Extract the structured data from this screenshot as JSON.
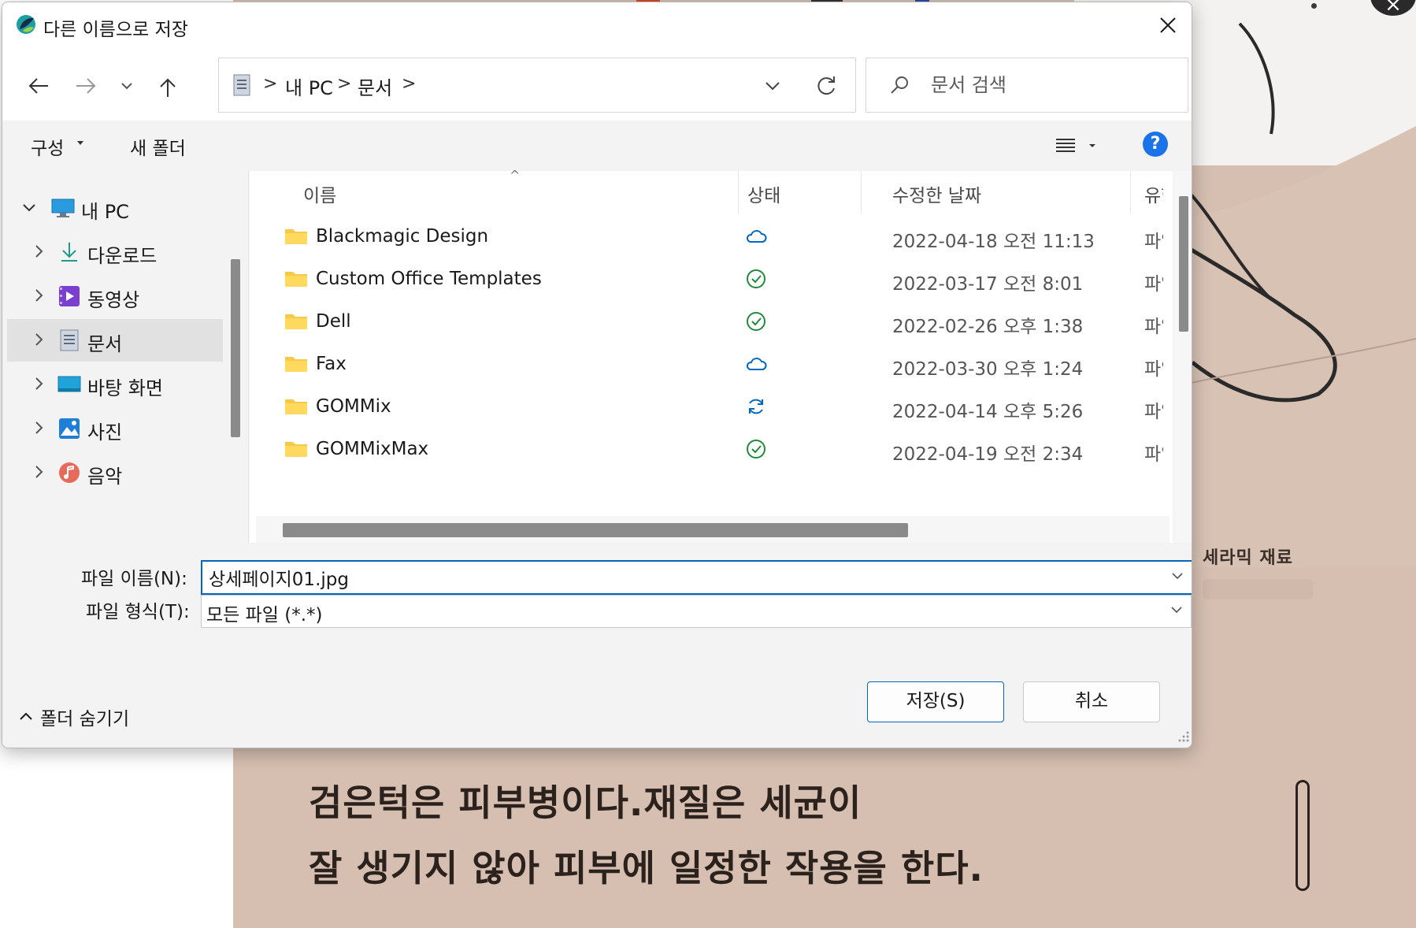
{
  "background": {
    "side_label": "세라믹 재료",
    "text_line1": "검은턱은 피부병이다.재질은 세균이",
    "text_line2": "잘 생기지 않아 피부에 일정한 작용을 한다.",
    "close_glyph": "×"
  },
  "dialog": {
    "title": "다른 이름으로 저장",
    "nav": {
      "back_icon": "arrow-left-icon",
      "forward_icon": "arrow-right-icon",
      "recent_icon": "chevron-down-icon",
      "up_icon": "arrow-up-icon"
    },
    "address": {
      "crumbs": [
        "내 PC",
        "문서"
      ],
      "separator": ">"
    },
    "search": {
      "placeholder": "문서 검색"
    },
    "toolbar": {
      "organize_label": "구성",
      "new_folder_label": "새 폴더",
      "help_label": "?"
    },
    "tree": {
      "root": "내 PC",
      "items": [
        {
          "label": "다운로드",
          "icon": "download-icon"
        },
        {
          "label": "동영상",
          "icon": "video-icon"
        },
        {
          "label": "문서",
          "icon": "documents-icon",
          "selected": true
        },
        {
          "label": "바탕 화면",
          "icon": "desktop-icon"
        },
        {
          "label": "사진",
          "icon": "pictures-icon"
        },
        {
          "label": "음악",
          "icon": "music-icon"
        }
      ]
    },
    "columns": {
      "name": "이름",
      "status": "상태",
      "modified": "수정한 날짜",
      "type": "유형"
    },
    "files": [
      {
        "name": "Blackmagic Design",
        "status": "cloud-icon",
        "modified": "2022-04-18 오전 11:13",
        "type": "파일 폴더"
      },
      {
        "name": "Custom Office Templates",
        "status": "synced-check-icon",
        "modified": "2022-03-17 오전 8:01",
        "type": "파일 폴더"
      },
      {
        "name": "Dell",
        "status": "synced-check-icon",
        "modified": "2022-02-26 오후 1:38",
        "type": "파일 폴더"
      },
      {
        "name": "Fax",
        "status": "cloud-icon",
        "modified": "2022-03-30 오후 1:24",
        "type": "파일 폴더"
      },
      {
        "name": "GOMMix",
        "status": "syncing-icon",
        "modified": "2022-04-14 오후 5:26",
        "type": "파일 폴더"
      },
      {
        "name": "GOMMixMax",
        "status": "synced-check-icon",
        "modified": "2022-04-19 오전 2:34",
        "type": "파일 폴더"
      }
    ],
    "filename_label": "파일 이름(N):",
    "filename_value": "상세페이지01.jpg",
    "filetype_label": "파일 형식(T):",
    "filetype_value": "모든 파일 (*.*)",
    "hide_folders_label": "폴더 숨기기",
    "save_label": "저장(S)",
    "cancel_label": "취소",
    "colors": {
      "accent": "#0067c0",
      "selected_row": "#e1e1e1",
      "synced_green": "#1f8a3b",
      "cloud_blue": "#0067c0",
      "folder_yellow": "#f7c948"
    }
  }
}
